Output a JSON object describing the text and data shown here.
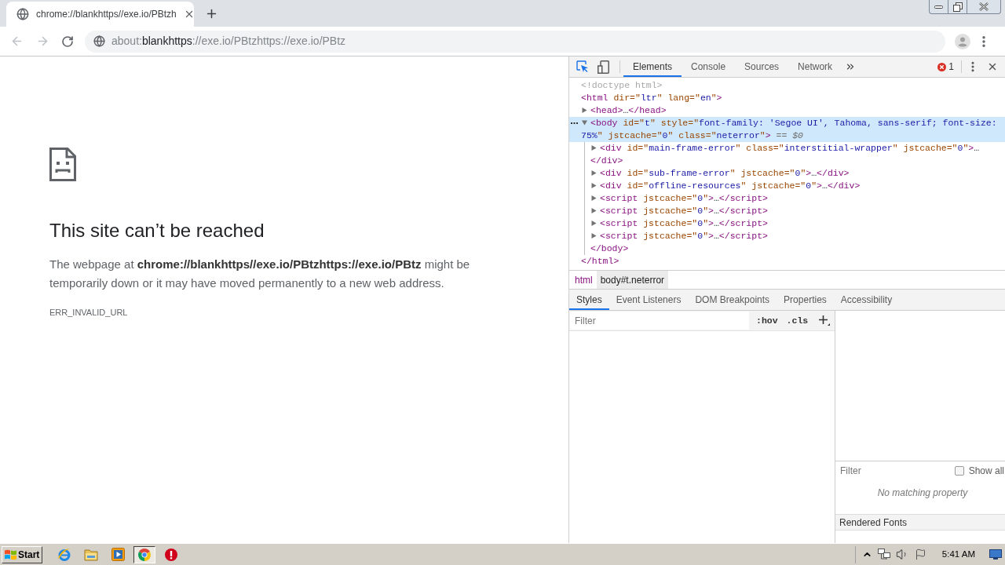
{
  "browser": {
    "tabs": [
      {
        "title": "chrome://blankhttps//exe.io/PBtzh",
        "selected": true
      }
    ],
    "navigation": {
      "back": {
        "disabled": true
      },
      "forward": {
        "disabled": true
      }
    },
    "address": [
      {
        "text": "about:",
        "emphasized": false
      },
      {
        "text": "blankhttps",
        "emphasized": true
      },
      {
        "text": "://exe.io/PBtzhttps://exe.io/PBtz",
        "emphasized": false
      }
    ]
  },
  "page": {
    "heading": "This site can’t be reached",
    "message": "The webpage at **chrome://blankhttps//exe.io/PBtzhttps://exe.io/PBtz** might be temporarily down or it may have moved permanently to a new web address.",
    "error_code": "ERR_INVALID_URL"
  },
  "devtools": {
    "tabs": [
      {
        "label": "Elements",
        "selected": true
      },
      {
        "label": "Console",
        "selected": false
      },
      {
        "label": "Sources",
        "selected": false
      },
      {
        "label": "Network",
        "selected": false
      }
    ],
    "error_count": "1",
    "dom_tree": [
      {
        "selected": false,
        "open": [
          {
            "kind": "muted",
            "text": "<!doctype html>"
          }
        ]
      },
      {
        "selected": false,
        "open": [
          {
            "kind": "tag",
            "text": "<html"
          },
          {
            "kind": "attr",
            "text": " dir=\""
          },
          {
            "kind": "value",
            "text": "ltr"
          },
          {
            "kind": "attr",
            "text": "\" lang=\""
          },
          {
            "kind": "value",
            "text": "en"
          },
          {
            "kind": "attr",
            "text": "\""
          },
          {
            "kind": "tag",
            "text": ">"
          }
        ],
        "close": [
          {
            "kind": "tag",
            "text": "</html>"
          }
        ],
        "children": [
          {
            "selected": false,
            "expanded": false,
            "open": [
              {
                "kind": "tag",
                "text": "<head>"
              },
              {
                "kind": "plain",
                "text": "…"
              },
              {
                "kind": "tag",
                "text": "</head>"
              }
            ]
          },
          {
            "selected": true,
            "expanded": true,
            "open": [
              {
                "kind": "tag",
                "text": "<body"
              },
              {
                "kind": "attr",
                "text": " id=\""
              },
              {
                "kind": "value",
                "text": "t"
              },
              {
                "kind": "attr",
                "text": "\" style=\""
              },
              {
                "kind": "value",
                "text": "font-family: 'Segoe UI', Tahoma, sans-serif; font-size: 75%"
              },
              {
                "kind": "attr",
                "text": "\" jstcache=\""
              },
              {
                "kind": "value",
                "text": "0"
              },
              {
                "kind": "attr",
                "text": "\" class=\""
              },
              {
                "kind": "value",
                "text": "neterror"
              },
              {
                "kind": "attr",
                "text": "\""
              },
              {
                "kind": "tag",
                "text": ">"
              },
              {
                "kind": "hint",
                "text": " == $0"
              }
            ],
            "close": [
              {
                "kind": "tag",
                "text": "</body>"
              }
            ],
            "children": [
              {
                "selected": false,
                "expanded": false,
                "open": [
                  {
                    "kind": "tag",
                    "text": "<div"
                  },
                  {
                    "kind": "attr",
                    "text": " id=\""
                  },
                  {
                    "kind": "value",
                    "text": "main-frame-error"
                  },
                  {
                    "kind": "attr",
                    "text": "\" class=\""
                  },
                  {
                    "kind": "value",
                    "text": "interstitial-wrapper"
                  },
                  {
                    "kind": "attr",
                    "text": "\" jstcache=\""
                  },
                  {
                    "kind": "value",
                    "text": "0"
                  },
                  {
                    "kind": "attr",
                    "text": "\""
                  },
                  {
                    "kind": "tag",
                    "text": ">"
                  },
                  {
                    "kind": "plain",
                    "text": "…"
                  },
                  {
                    "kind": "tag",
                    "text": "</div>"
                  }
                ]
              },
              {
                "selected": false,
                "expanded": false,
                "open": [
                  {
                    "kind": "tag",
                    "text": "<div"
                  },
                  {
                    "kind": "attr",
                    "text": " id=\""
                  },
                  {
                    "kind": "value",
                    "text": "sub-frame-error"
                  },
                  {
                    "kind": "attr",
                    "text": "\" jstcache=\""
                  },
                  {
                    "kind": "value",
                    "text": "0"
                  },
                  {
                    "kind": "attr",
                    "text": "\""
                  },
                  {
                    "kind": "tag",
                    "text": ">"
                  },
                  {
                    "kind": "plain",
                    "text": "…"
                  },
                  {
                    "kind": "tag",
                    "text": "</div>"
                  }
                ]
              },
              {
                "selected": false,
                "expanded": false,
                "open": [
                  {
                    "kind": "tag",
                    "text": "<div"
                  },
                  {
                    "kind": "attr",
                    "text": " id=\""
                  },
                  {
                    "kind": "value",
                    "text": "offline-resources"
                  },
                  {
                    "kind": "attr",
                    "text": "\" jstcache=\""
                  },
                  {
                    "kind": "value",
                    "text": "0"
                  },
                  {
                    "kind": "attr",
                    "text": "\""
                  },
                  {
                    "kind": "tag",
                    "text": ">"
                  },
                  {
                    "kind": "plain",
                    "text": "…"
                  },
                  {
                    "kind": "tag",
                    "text": "</div>"
                  }
                ]
              },
              {
                "selected": false,
                "expanded": false,
                "open": [
                  {
                    "kind": "tag",
                    "text": "<script"
                  },
                  {
                    "kind": "attr",
                    "text": " jstcache=\""
                  },
                  {
                    "kind": "value",
                    "text": "0"
                  },
                  {
                    "kind": "attr",
                    "text": "\""
                  },
                  {
                    "kind": "tag",
                    "text": ">"
                  },
                  {
                    "kind": "plain",
                    "text": "…"
                  },
                  {
                    "kind": "tag",
                    "text": "</script>"
                  }
                ]
              },
              {
                "selected": false,
                "expanded": false,
                "open": [
                  {
                    "kind": "tag",
                    "text": "<script"
                  },
                  {
                    "kind": "attr",
                    "text": " jstcache=\""
                  },
                  {
                    "kind": "value",
                    "text": "0"
                  },
                  {
                    "kind": "attr",
                    "text": "\""
                  },
                  {
                    "kind": "tag",
                    "text": ">"
                  },
                  {
                    "kind": "plain",
                    "text": "…"
                  },
                  {
                    "kind": "tag",
                    "text": "</script>"
                  }
                ]
              },
              {
                "selected": false,
                "expanded": false,
                "open": [
                  {
                    "kind": "tag",
                    "text": "<script"
                  },
                  {
                    "kind": "attr",
                    "text": " jstcache=\""
                  },
                  {
                    "kind": "value",
                    "text": "0"
                  },
                  {
                    "kind": "attr",
                    "text": "\""
                  },
                  {
                    "kind": "tag",
                    "text": ">"
                  },
                  {
                    "kind": "plain",
                    "text": "…"
                  },
                  {
                    "kind": "tag",
                    "text": "</script>"
                  }
                ]
              },
              {
                "selected": false,
                "expanded": false,
                "open": [
                  {
                    "kind": "tag",
                    "text": "<script"
                  },
                  {
                    "kind": "attr",
                    "text": " jstcache=\""
                  },
                  {
                    "kind": "value",
                    "text": "0"
                  },
                  {
                    "kind": "attr",
                    "text": "\""
                  },
                  {
                    "kind": "tag",
                    "text": ">"
                  },
                  {
                    "kind": "plain",
                    "text": "…"
                  },
                  {
                    "kind": "tag",
                    "text": "</script>"
                  }
                ]
              }
            ]
          }
        ]
      }
    ],
    "breadcrumbs": [
      {
        "label": "html",
        "selected": false
      },
      {
        "label": "body#t.neterror",
        "selected": true
      }
    ],
    "sidebar_tabs": [
      {
        "label": "Styles",
        "selected": true
      },
      {
        "label": "Event Listeners",
        "selected": false
      },
      {
        "label": "DOM Breakpoints",
        "selected": false
      },
      {
        "label": "Properties",
        "selected": false
      },
      {
        "label": "Accessibility",
        "selected": false
      }
    ],
    "styles": {
      "filter": {
        "placeholder": "Filter"
      },
      "buttons": [
        ":hov",
        ".cls"
      ]
    },
    "computed": {
      "filter": {
        "placeholder": "Filter"
      },
      "show_all": {
        "label": "Show all",
        "checked": false
      },
      "empty_message": "No matching property",
      "sections": [
        "Rendered Fonts"
      ]
    }
  },
  "taskbar": {
    "start": "Start",
    "apps": [
      {
        "kind": "web",
        "selected": false
      },
      {
        "kind": "files",
        "selected": false
      },
      {
        "kind": "media",
        "selected": false
      },
      {
        "kind": "browser",
        "selected": true
      },
      {
        "kind": "security",
        "selected": false
      }
    ],
    "clock": "5:41 AM"
  }
}
